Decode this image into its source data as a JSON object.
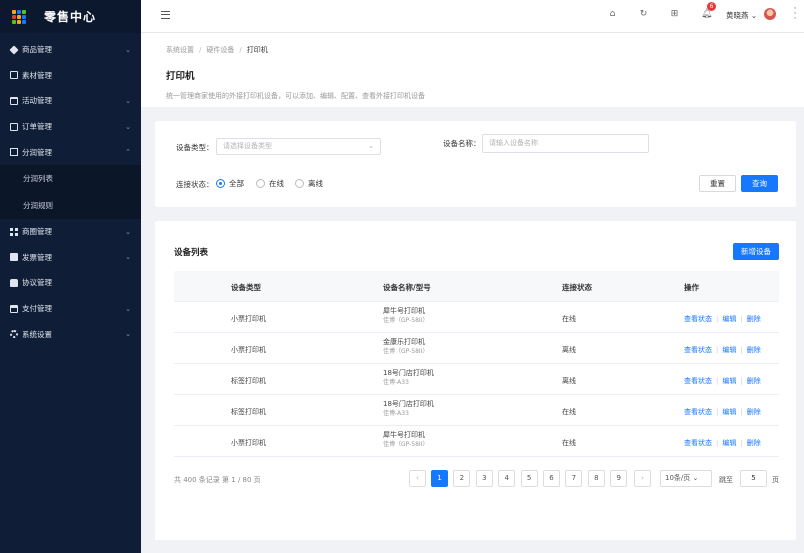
{
  "sidebar": {
    "title": "零售中心",
    "logo_colors": [
      "#f5a623",
      "#1677ff",
      "#52c41a",
      "#e53935",
      "#f5a623",
      "#1677ff",
      "#52c41a",
      "#f5a623",
      "#1677ff"
    ],
    "items": [
      {
        "label": "商品管理",
        "icon": "tag-icon",
        "arrow": "⌄"
      },
      {
        "label": "素材管理",
        "icon": "document-icon",
        "arrow": ""
      },
      {
        "label": "活动管理",
        "icon": "calendar-icon",
        "arrow": "⌄"
      },
      {
        "label": "订单管理",
        "icon": "order-icon",
        "arrow": "⌄"
      },
      {
        "label": "分润管理",
        "icon": "box-icon",
        "arrow": "⌃"
      }
    ],
    "subitems": [
      {
        "label": "分润列表"
      },
      {
        "label": "分润规则"
      }
    ],
    "items2": [
      {
        "label": "商圈管理",
        "icon": "grid-icon",
        "arrow": "⌄"
      },
      {
        "label": "发票管理",
        "icon": "invoice-icon",
        "arrow": "⌄"
      },
      {
        "label": "协议管理",
        "icon": "lock-icon",
        "arrow": ""
      },
      {
        "label": "支付管理",
        "icon": "payment-icon",
        "arrow": "⌄"
      },
      {
        "label": "系统设置",
        "icon": "gear-icon",
        "arrow": "⌄"
      }
    ]
  },
  "header": {
    "badge": "6",
    "username": "黄晓燕 ⌄"
  },
  "page": {
    "breadcrumb": [
      "系统设置",
      "硬件设备",
      "打印机"
    ],
    "title": "打印机",
    "description": "统一管理商家使用的外接打印机设备，可以添加、编辑、配置、查看外接打印机设备"
  },
  "filter": {
    "type_label": "设备类型：",
    "type_placeholder": "请选择设备类型",
    "name_label": "设备名称：",
    "name_placeholder": "请输入设备名称",
    "status_label": "连接状态：",
    "status_options": [
      "全部",
      "在线",
      "离线"
    ],
    "reset_label": "重置",
    "search_label": "查询"
  },
  "list": {
    "title": "设备列表",
    "add_label": "新增设备",
    "columns": [
      "设备类型",
      "设备名称/型号",
      "连接状态",
      "操作"
    ],
    "rows": [
      {
        "type": "小票打印机",
        "name": "犀牛号打印机",
        "model": "佳博（GP-58II）",
        "status": "在线"
      },
      {
        "type": "小票打印机",
        "name": "金康乐打印机",
        "model": "佳博（GP-58II）",
        "status": "离线"
      },
      {
        "type": "标签打印机",
        "name": "18号门店打印机",
        "model": "佳博-A33",
        "status": "离线"
      },
      {
        "type": "标签打印机",
        "name": "18号门店打印机",
        "model": "佳博-A33",
        "status": "在线"
      },
      {
        "type": "小票打印机",
        "name": "犀牛号打印机",
        "model": "佳博（GP-58II）",
        "status": "在线"
      }
    ],
    "ops": [
      "查看状态",
      "编辑",
      "删除"
    ]
  },
  "pagination": {
    "total_text": "共 400 条记录 第 1 / 80 页",
    "prev": "‹",
    "next": "›",
    "pages": [
      "1",
      "2",
      "3",
      "4",
      "5",
      "6",
      "7",
      "8",
      "9"
    ],
    "page_size": "10条/页 ⌄",
    "jump_label": "跳至",
    "jump_value": "5",
    "jump_suffix": "页"
  }
}
